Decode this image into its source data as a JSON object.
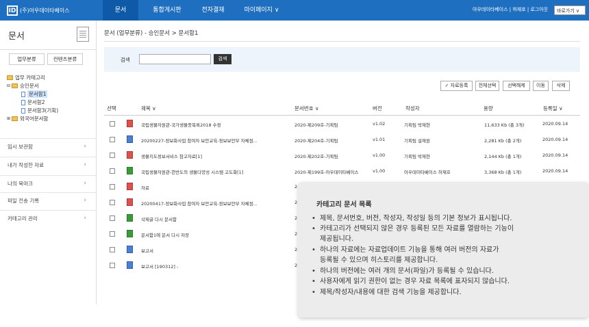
{
  "header": {
    "logo_mark": "ID",
    "logo_text": "(주)아우데이타베이스",
    "nav": [
      "문서",
      "통합게시판",
      "전자결재",
      "마이페이지 ∨"
    ],
    "user_text": "아우데이타베이스 | 허재호 | 로그아웃",
    "lang_select": "바로가기 ∨"
  },
  "sidebar": {
    "title": "문서",
    "tabs": [
      "업무분류",
      "컨텐츠분류"
    ],
    "tree": [
      "업무 카테고리",
      "승인문서",
      "문서함1",
      "문서함2",
      "문서함3(기획)",
      "외국어문서함"
    ],
    "menu": [
      "임시 보관함",
      "내가 작성한 자료",
      "나의 북마크",
      "파일 전송 기록",
      "카테고리 관리"
    ]
  },
  "breadcrumb": "문서 (업무분류)   -   승인문서 > 문서함1",
  "search": {
    "label": "검색",
    "button": "검색",
    "value": ""
  },
  "actions": [
    "✓ 자료등록",
    "전체선택",
    "선택해제",
    "이동",
    "삭제"
  ],
  "table": {
    "headers": [
      "선택",
      "제목 ∨",
      "문서번호 ∨",
      "버전",
      "작성자",
      "용량",
      "등록일 ∨"
    ],
    "rows": [
      {
        "icon": "pdf",
        "title": "국립생물자원관-국가생물종목록2018 수정",
        "docno": "2020-제209호-기획팀",
        "ver": "v1.02",
        "author": "기획팀 박재현",
        "size": "11,633 Kb (총 3개)",
        "date": "2020.09.14"
      },
      {
        "icon": "doc",
        "title": "20200227-정보화사업 참여자 보안교육-정보보안부 자체점...",
        "docno": "2020-제204호-기획팀",
        "ver": "v1.01",
        "author": "기획팀 설재원",
        "size": "2,281 Kb (총 2개)",
        "date": "2020.09.14"
      },
      {
        "icon": "pdf",
        "title": "생물지도정보서비스 참고자료[1]",
        "docno": "2020-제202호-기획팀",
        "ver": "v1.00",
        "author": "기획팀 박재현",
        "size": "2,144 Kb (총 1개)",
        "date": "2020.09.14"
      },
      {
        "icon": "xls",
        "title": "국립생물자원관-한반도의 생물다양성 시스템 고도화[1]",
        "docno": "2020-제199호-아우데이타베이스",
        "ver": "v1.00",
        "author": "아우데이타베이스 허재호",
        "size": "3,368 Kb (총 1개)",
        "date": "2020.09.14"
      },
      {
        "icon": "pdf",
        "title": "자료",
        "docno": "2",
        "ver": "",
        "author": "",
        "size": "",
        "date": ""
      },
      {
        "icon": "pdf",
        "title": "20200417-정보화사업 참여자 보안교육-정보보안부 자체점...",
        "docno": "2",
        "ver": "",
        "author": "",
        "size": "",
        "date": ""
      },
      {
        "icon": "xls",
        "title": "삭제글 다시 문서함",
        "docno": "2",
        "ver": "",
        "author": "",
        "size": "",
        "date": ""
      },
      {
        "icon": "xls",
        "title": "문서함1에 문서 다시 저장",
        "docno": "2",
        "ver": "",
        "author": "",
        "size": "",
        "date": ""
      },
      {
        "icon": "doc",
        "title": "보고서",
        "docno": "2",
        "ver": "",
        "author": "",
        "size": "",
        "date": ""
      },
      {
        "icon": "doc",
        "title": "보고서 [190312] -",
        "docno": "2",
        "ver": "",
        "author": "",
        "size": "",
        "date": ""
      }
    ]
  },
  "popup": {
    "title": "카테고리 문서 목록",
    "items": [
      "제목, 문서번호, 버전, 작성자, 작성일 등의 기본 정보가 표시됩니다.",
      "카테고리가 선택되지 않은 경우 등록된 모든 자료를 열람하는 기능이",
      "제공됩니다.",
      "하나의 자료에는 자료업데이트 기능을 통해 여러 버전의 자료가",
      "등록될 수 있으며 히스토리를 제공합니다.",
      "하나의 버전에는 여러 개의 문서(파일)가 등록될 수 있습니다.",
      "사용자에게 읽기 권한이 없는 경우 자료 목록에 표자되지 않습니다.",
      "제목/작성자/내용에 대한 검색 기능을 제공합니다."
    ]
  },
  "colors": {
    "topbar": "#1f6fc1",
    "active_nav": "#0e5aa8",
    "popup_bg": "#ececec"
  }
}
